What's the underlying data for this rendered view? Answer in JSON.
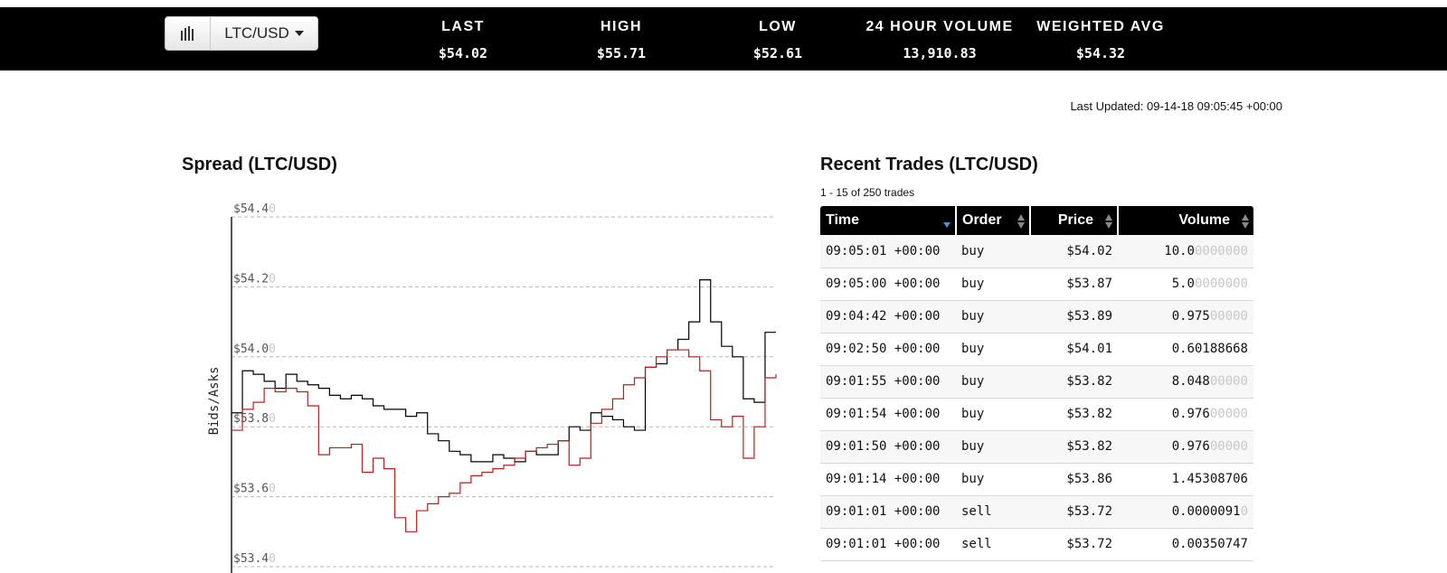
{
  "header": {
    "pair_label": "LTC/USD",
    "chart_toggle_icon": "bar-chart-icon",
    "stats": [
      {
        "label": "LAST",
        "value": "$54.02"
      },
      {
        "label": "HIGH",
        "value": "$55.71"
      },
      {
        "label": "LOW",
        "value": "$52.61"
      },
      {
        "label": "24 HOUR VOLUME",
        "value": "13,910.83"
      },
      {
        "label": "WEIGHTED AVG",
        "value": "$54.32"
      }
    ]
  },
  "last_updated": "Last Updated: 09-14-18 09:05:45 +00:00",
  "spread": {
    "title": "Spread (LTC/USD)"
  },
  "chart_data": {
    "type": "line",
    "title": "Spread (LTC/USD)",
    "xlabel": "",
    "ylabel": "Bids/Asks",
    "ylim": [
      53.4,
      54.4
    ],
    "yticks": [
      54.4,
      54.2,
      54.0,
      53.8,
      53.6,
      53.4
    ],
    "ytick_labels": [
      {
        "main": "$54.4",
        "dim": "0"
      },
      {
        "main": "$54.2",
        "dim": "0"
      },
      {
        "main": "$54.0",
        "dim": "0"
      },
      {
        "main": "$53.8",
        "dim": "0"
      },
      {
        "main": "$53.6",
        "dim": "0"
      },
      {
        "main": "$53.4",
        "dim": "0"
      }
    ],
    "grid": true,
    "x": [
      0,
      2,
      4,
      6,
      8,
      10,
      12,
      14,
      16,
      18,
      20,
      22,
      24,
      26,
      28,
      30,
      32,
      34,
      36,
      38,
      40,
      42,
      44,
      46,
      48,
      50,
      52,
      54,
      56,
      58,
      60,
      62,
      64,
      66,
      68,
      70,
      72,
      74,
      76,
      78,
      80,
      82,
      84,
      86,
      88,
      90,
      92,
      94,
      96,
      98,
      100
    ],
    "series": [
      {
        "color": "#000000",
        "values": [
          53.84,
          53.96,
          53.95,
          53.93,
          53.91,
          53.95,
          53.93,
          53.92,
          53.91,
          53.89,
          53.88,
          53.89,
          53.88,
          53.86,
          53.85,
          53.85,
          53.83,
          53.84,
          53.78,
          53.76,
          53.73,
          53.72,
          53.7,
          53.7,
          53.72,
          53.71,
          53.7,
          53.73,
          53.72,
          53.72,
          53.76,
          53.8,
          53.79,
          53.84,
          53.83,
          53.82,
          53.8,
          53.79,
          53.97,
          53.98,
          54.02,
          54.05,
          54.1,
          54.22,
          54.1,
          54.03,
          54.0,
          53.88,
          53.87,
          54.07,
          54.07
        ]
      },
      {
        "color": "#b22222",
        "values": [
          53.79,
          53.85,
          53.87,
          53.91,
          53.9,
          53.91,
          53.9,
          53.86,
          53.72,
          53.74,
          53.74,
          53.75,
          53.67,
          53.71,
          53.68,
          53.54,
          53.5,
          53.56,
          53.58,
          53.6,
          53.61,
          53.64,
          53.66,
          53.67,
          53.68,
          53.69,
          53.71,
          53.73,
          53.74,
          53.75,
          53.76,
          53.69,
          53.71,
          53.81,
          53.85,
          53.88,
          53.92,
          53.94,
          53.97,
          54.0,
          54.02,
          54.02,
          54.0,
          53.96,
          53.82,
          53.8,
          53.83,
          53.71,
          53.8,
          53.94,
          53.95
        ]
      }
    ]
  },
  "trades": {
    "title": "Recent Trades (LTC/USD)",
    "count_label": "1 - 15 of 250 trades",
    "columns": [
      {
        "label": "Time",
        "sort": "desc"
      },
      {
        "label": "Order",
        "sort": "none"
      },
      {
        "label": "Price",
        "sort": "none"
      },
      {
        "label": "Volume",
        "sort": "none"
      }
    ],
    "rows": [
      {
        "time": "09:05:01 +00:00",
        "order": "buy",
        "price": "$54.02",
        "vol_main": "10.0",
        "vol_dim": "0000000"
      },
      {
        "time": "09:05:00 +00:00",
        "order": "buy",
        "price": "$53.87",
        "vol_main": "5.0",
        "vol_dim": "0000000"
      },
      {
        "time": "09:04:42 +00:00",
        "order": "buy",
        "price": "$53.89",
        "vol_main": "0.975",
        "vol_dim": "00000"
      },
      {
        "time": "09:02:50 +00:00",
        "order": "buy",
        "price": "$54.01",
        "vol_main": "0.60188668",
        "vol_dim": ""
      },
      {
        "time": "09:01:55 +00:00",
        "order": "buy",
        "price": "$53.82",
        "vol_main": "8.048",
        "vol_dim": "00000"
      },
      {
        "time": "09:01:54 +00:00",
        "order": "buy",
        "price": "$53.82",
        "vol_main": "0.976",
        "vol_dim": "00000"
      },
      {
        "time": "09:01:50 +00:00",
        "order": "buy",
        "price": "$53.82",
        "vol_main": "0.976",
        "vol_dim": "00000"
      },
      {
        "time": "09:01:14 +00:00",
        "order": "buy",
        "price": "$53.86",
        "vol_main": "1.45308706",
        "vol_dim": ""
      },
      {
        "time": "09:01:01 +00:00",
        "order": "sell",
        "price": "$53.72",
        "vol_main": "0.0000091",
        "vol_dim": "0"
      },
      {
        "time": "09:01:01 +00:00",
        "order": "sell",
        "price": "$53.72",
        "vol_main": "0.00350747",
        "vol_dim": ""
      }
    ]
  }
}
